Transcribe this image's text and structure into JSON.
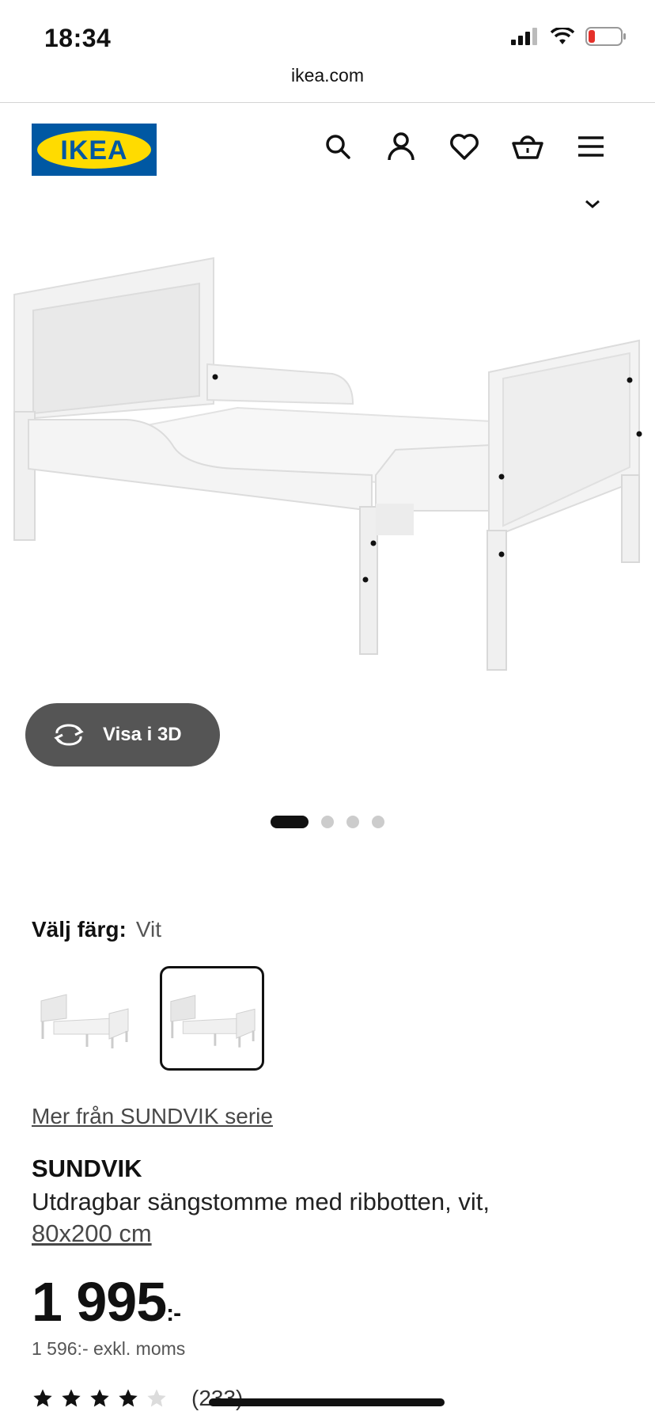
{
  "status_bar": {
    "time": "18:34"
  },
  "browser": {
    "url": "ikea.com"
  },
  "header": {
    "logo_text": "IKEA",
    "icons": [
      "search-icon",
      "account-icon",
      "heart-icon",
      "basket-icon",
      "menu-icon"
    ]
  },
  "gallery": {
    "view_3d_label": "Visa i 3D",
    "slide_count": 4,
    "active_slide": 1
  },
  "color_picker": {
    "label": "Välj färg:",
    "selected_value": "Vit"
  },
  "product": {
    "series_link": "Mer från SUNDVIK serie",
    "name": "SUNDVIK",
    "description": "Utdragbar sängstomme med ribbotten, vit,",
    "size_link": "80x200 cm",
    "price_main": "1 995",
    "price_suffix": ":-",
    "price_excl": "1 596:- exkl. moms",
    "rating_stars": 4,
    "rating_max": 5,
    "review_count": "(233)"
  },
  "colors": {
    "ikea_blue": "#0058A3",
    "ikea_yellow": "#FFDB00",
    "button_dark": "#555555"
  }
}
